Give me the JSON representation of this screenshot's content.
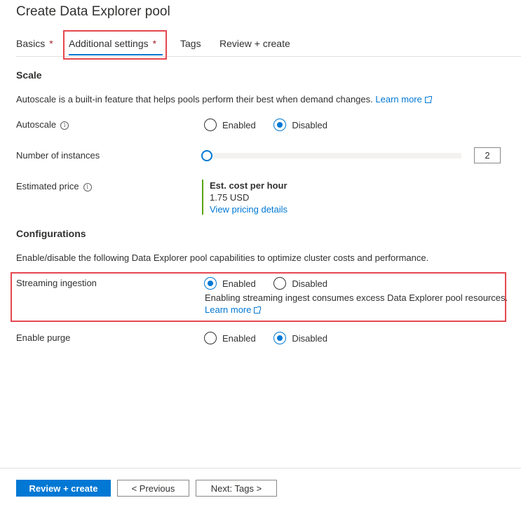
{
  "page": {
    "title": "Create Data Explorer pool"
  },
  "tabs": [
    {
      "label": "Basics",
      "required": "*"
    },
    {
      "label": "Additional settings",
      "required": "*",
      "active": true
    },
    {
      "label": "Tags"
    },
    {
      "label": "Review + create"
    }
  ],
  "scale": {
    "heading": "Scale",
    "description": "Autoscale is a built-in feature that helps pools perform their best when demand changes.",
    "learn_more": "Learn more",
    "autoscale": {
      "label": "Autoscale",
      "options": [
        "Enabled",
        "Disabled"
      ],
      "selected": "Disabled"
    },
    "instances": {
      "label": "Number of instances",
      "value": "2",
      "slider_fraction": 0.0
    },
    "price": {
      "label": "Estimated price",
      "heading": "Est. cost per hour",
      "value": "1.75 USD",
      "link": "View pricing details"
    }
  },
  "configurations": {
    "heading": "Configurations",
    "description": "Enable/disable the following Data Explorer pool capabilities to optimize cluster costs and performance.",
    "streaming": {
      "label": "Streaming ingestion",
      "options": [
        "Enabled",
        "Disabled"
      ],
      "selected": "Enabled",
      "note": "Enabling streaming ingest consumes excess Data Explorer pool resources.",
      "learn_more": "Learn more"
    },
    "purge": {
      "label": "Enable purge",
      "options": [
        "Enabled",
        "Disabled"
      ],
      "selected": "Disabled"
    }
  },
  "footer": {
    "review_create": "Review + create",
    "previous": "< Previous",
    "next": "Next: Tags >"
  },
  "colors": {
    "accent": "#0078d4",
    "highlight": "#e5474f",
    "price_bar": "#57a300",
    "required": "#a4262c"
  }
}
